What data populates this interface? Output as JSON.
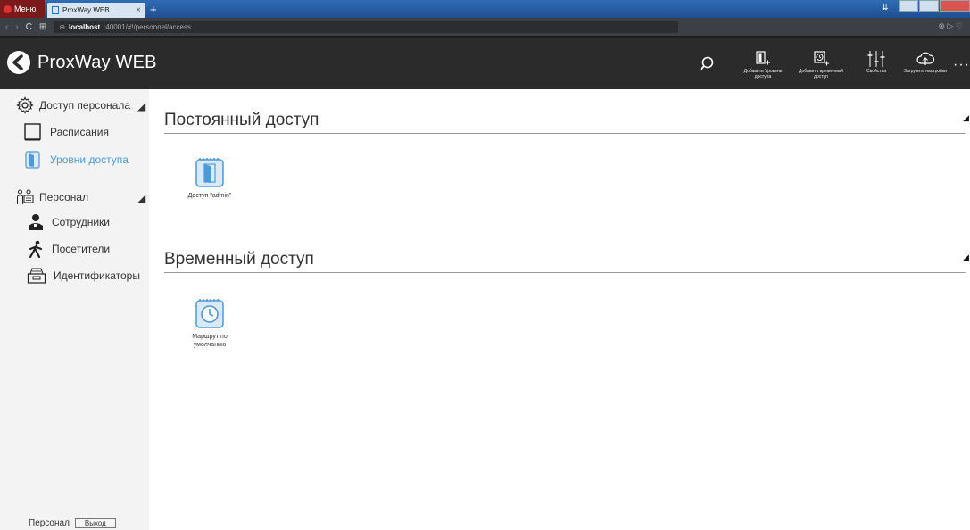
{
  "browser": {
    "menu_label": "Меню",
    "tab_title": "ProxWay WEB",
    "url_host": "localhost",
    "url_rest": ":40001/#!/personnel/access"
  },
  "app": {
    "title": "ProxWay WEB"
  },
  "toolbar": {
    "add_level_label": "Добавить Уровень доступа",
    "add_temp_label": "Добавить временный доступ",
    "properties_label": "Свойства",
    "load_settings_label": "Загрузить настройки"
  },
  "sidebar": {
    "group_access": "Доступ персонала",
    "item_schedules": "Расписания",
    "item_access_levels": "Уровни доступа",
    "group_personnel": "Персонал",
    "item_employees": "Сотрудники",
    "item_visitors": "Посетители",
    "item_identifiers": "Идентификаторы",
    "footer_label": "Персонал",
    "exit_label": "Выход"
  },
  "main": {
    "permanent_title": "Постоянный доступ",
    "permanent_items": [
      "Доступ \"admin\""
    ],
    "temporary_title": "Временный доступ",
    "temporary_items": [
      "Маршрут по умолчанию"
    ]
  },
  "colors": {
    "accent": "#4a9bd8",
    "header_bg": "#2b2b2b",
    "sidebar_bg": "#f3f3f3"
  }
}
